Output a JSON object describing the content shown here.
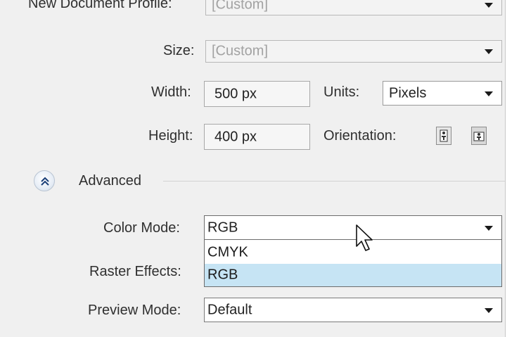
{
  "form": {
    "profile": {
      "label": "New Document Profile:",
      "value": "[Custom]"
    },
    "size": {
      "label": "Size:",
      "value": "[Custom]"
    },
    "width": {
      "label": "Width:",
      "value": "500 px"
    },
    "units": {
      "label": "Units:",
      "value": "Pixels"
    },
    "height": {
      "label": "Height:",
      "value": "400 px"
    },
    "orientation": {
      "label": "Orientation:"
    },
    "advanced": {
      "label": "Advanced",
      "icon": "chevron-double-up-icon"
    },
    "color_mode": {
      "label": "Color Mode:",
      "value": "RGB",
      "options": [
        "CMYK",
        "RGB"
      ],
      "selected_option": "RGB"
    },
    "raster_effects": {
      "label": "Raster Effects:"
    },
    "preview_mode": {
      "label": "Preview Mode:",
      "value": "Default"
    }
  },
  "colors": {
    "panel_bg": "#f0f0f0",
    "selected_option_bg": "#c6e4f4",
    "field_border": "#9a9a9a"
  }
}
